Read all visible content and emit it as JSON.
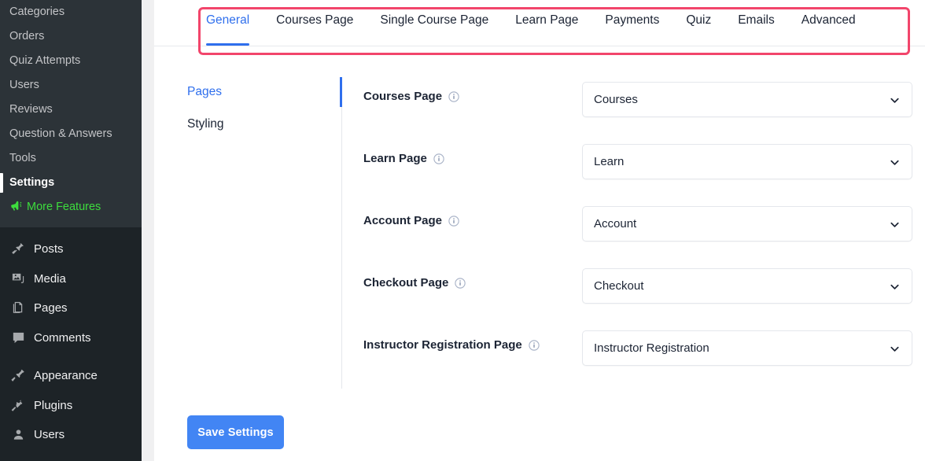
{
  "sidebar": {
    "submenu_items": [
      {
        "label": "Categories",
        "state": "normal"
      },
      {
        "label": "Orders",
        "state": "normal"
      },
      {
        "label": "Quiz Attempts",
        "state": "normal"
      },
      {
        "label": "Users",
        "state": "normal"
      },
      {
        "label": "Reviews",
        "state": "normal"
      },
      {
        "label": "Question & Answers",
        "state": "normal"
      },
      {
        "label": "Tools",
        "state": "normal"
      },
      {
        "label": "Settings",
        "state": "active"
      },
      {
        "label": "More Features",
        "state": "promo",
        "icon": "megaphone-icon"
      }
    ],
    "menu_items": [
      {
        "label": "Posts",
        "icon": "pin-icon"
      },
      {
        "label": "Media",
        "icon": "media-icon"
      },
      {
        "label": "Pages",
        "icon": "pages-icon"
      },
      {
        "label": "Comments",
        "icon": "comment-icon"
      },
      {
        "label": "Appearance",
        "icon": "appearance-icon"
      },
      {
        "label": "Plugins",
        "icon": "plug-icon"
      },
      {
        "label": "Users",
        "icon": "user-icon"
      }
    ],
    "colors": {
      "background": "#1d2327",
      "submenu_background": "#2c3338",
      "promo_text": "#3ddc3d"
    }
  },
  "tabs": [
    {
      "label": "General",
      "active": true
    },
    {
      "label": "Courses Page",
      "active": false
    },
    {
      "label": "Single Course Page",
      "active": false
    },
    {
      "label": "Learn Page",
      "active": false
    },
    {
      "label": "Payments",
      "active": false
    },
    {
      "label": "Quiz",
      "active": false
    },
    {
      "label": "Emails",
      "active": false
    },
    {
      "label": "Advanced",
      "active": false
    }
  ],
  "annotation": {
    "shape": "rectangle",
    "color": "#f2456b",
    "target": "tab-bar"
  },
  "subnav": [
    {
      "label": "Pages",
      "active": true
    },
    {
      "label": "Styling",
      "active": false
    }
  ],
  "fields": [
    {
      "label": "Courses Page",
      "info_icon": "info-icon",
      "value": "Courses",
      "control": "select"
    },
    {
      "label": "Learn Page",
      "info_icon": "info-icon",
      "value": "Learn",
      "control": "select"
    },
    {
      "label": "Account Page",
      "info_icon": "info-icon",
      "value": "Account",
      "control": "select"
    },
    {
      "label": "Checkout Page",
      "info_icon": "info-icon",
      "value": "Checkout",
      "control": "select"
    },
    {
      "label": "Instructor Registration Page",
      "info_icon": "info-icon",
      "value": "Instructor Registration",
      "control": "select"
    }
  ],
  "actions": {
    "save_label": "Save Settings",
    "save_color": "#4285f4"
  },
  "theme": {
    "accent": "#2f6fed",
    "text": "#1c2434",
    "border": "#e4e7ec"
  }
}
